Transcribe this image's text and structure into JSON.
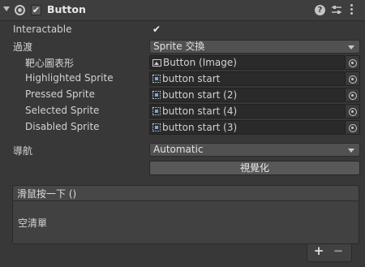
{
  "component": {
    "title": "Button",
    "enabled": true,
    "help_icon": "help-icon",
    "help_glyph": "?",
    "presets_icon": "presets-icon",
    "menu_icon": "more-icon"
  },
  "properties": {
    "interactable": {
      "label": "Interactable",
      "checked": true,
      "check_glyph": "✔"
    },
    "transition": {
      "label": "過渡",
      "value": "Sprite 交換"
    },
    "target_graphic": {
      "label": "靶心圖表形",
      "value": "Button (Image)"
    },
    "highlighted_sprite": {
      "label": "Highlighted Sprite",
      "value": "button start"
    },
    "pressed_sprite": {
      "label": "Pressed Sprite",
      "value": "button start (2)"
    },
    "selected_sprite": {
      "label": "Selected Sprite",
      "value": "button start (4)"
    },
    "disabled_sprite": {
      "label": "Disabled Sprite",
      "value": "button start (3)"
    },
    "navigation": {
      "label": "導航",
      "value": "Automatic"
    },
    "visualize_button": "視覺化"
  },
  "on_click": {
    "title": "滑鼠按一下 ()",
    "empty_text": "空清單",
    "add_label": "+",
    "remove_label": "−"
  },
  "colors": {
    "background": "#383838",
    "field": "#2a2a2a",
    "button": "#585858",
    "text": "#d2d2d2"
  }
}
